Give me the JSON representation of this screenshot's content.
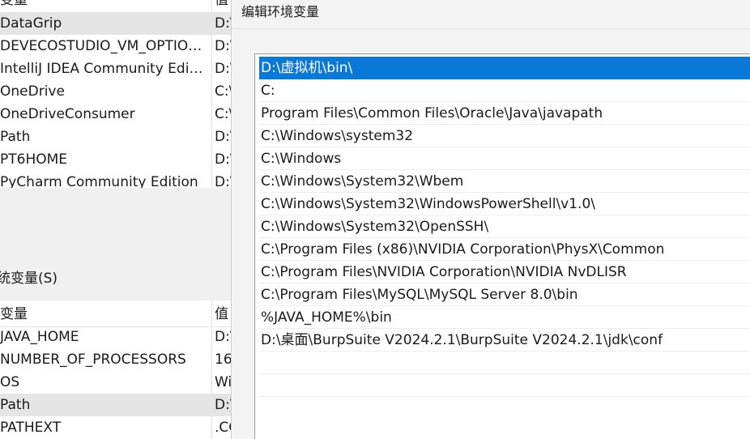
{
  "user_variables": {
    "header_name": "变量",
    "header_value": "值",
    "rows": [
      {
        "name": "DataGrip",
        "value": "D:\\"
      },
      {
        "name": "DEVECOSTUDIO_VM_OPTIONS",
        "value": "D:\\"
      },
      {
        "name": "IntelliJ IDEA Community Edition",
        "value": "D:\\"
      },
      {
        "name": "OneDrive",
        "value": "C:\\"
      },
      {
        "name": "OneDriveConsumer",
        "value": "C:\\"
      },
      {
        "name": "Path",
        "value": "D:\\"
      },
      {
        "name": "PT6HOME",
        "value": "D:\\"
      },
      {
        "name": "PyCharm Community Edition",
        "value": "D:\\"
      }
    ]
  },
  "system_variables": {
    "section_label": "统变量(S)",
    "header_name": "变量",
    "header_value": "值",
    "rows": [
      {
        "name": "JAVA_HOME",
        "value": "D:\\"
      },
      {
        "name": "NUMBER_OF_PROCESSORS",
        "value": "16"
      },
      {
        "name": "OS",
        "value": "Wi"
      },
      {
        "name": "Path",
        "value": "D:\\"
      },
      {
        "name": "PATHEXT",
        "value": ".CO"
      }
    ]
  },
  "dialog": {
    "title": "编辑环境变量",
    "entries": [
      "D:\\虚拟机\\bin\\",
      "C:",
      "Program Files\\Common Files\\Oracle\\Java\\javapath",
      "C:\\Windows\\system32",
      "C:\\Windows",
      "C:\\Windows\\System32\\Wbem",
      "C:\\Windows\\System32\\WindowsPowerShell\\v1.0\\",
      "C:\\Windows\\System32\\OpenSSH\\",
      "C:\\Program Files (x86)\\NVIDIA Corporation\\PhysX\\Common",
      "C:\\Program Files\\NVIDIA Corporation\\NVIDIA NvDLISR",
      "C:\\Program Files\\MySQL\\MySQL Server 8.0\\bin",
      "%JAVA_HOME%\\bin",
      "D:\\桌面\\BurpSuite V2024.2.1\\BurpSuite V2024.2.1\\jdk\\conf",
      "",
      ""
    ]
  }
}
